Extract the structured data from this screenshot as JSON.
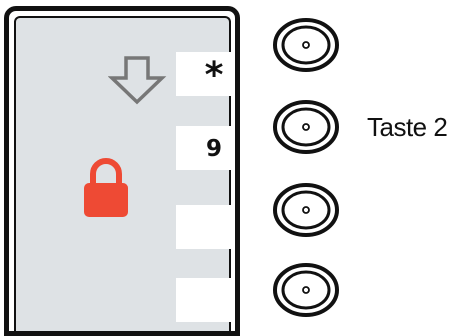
{
  "screen": {
    "softkeys": [
      {
        "label": "*"
      },
      {
        "label": "9"
      },
      {
        "label": ""
      },
      {
        "label": ""
      }
    ],
    "icons": {
      "arrow": "down-arrow-icon",
      "lock": "padlock-icon"
    }
  },
  "callout": {
    "label": "Taste 2"
  },
  "colors": {
    "screen_background": "#dee2e5",
    "lock": "#ee4a34",
    "arrow_outline": "#777777",
    "frame": "#111111"
  }
}
